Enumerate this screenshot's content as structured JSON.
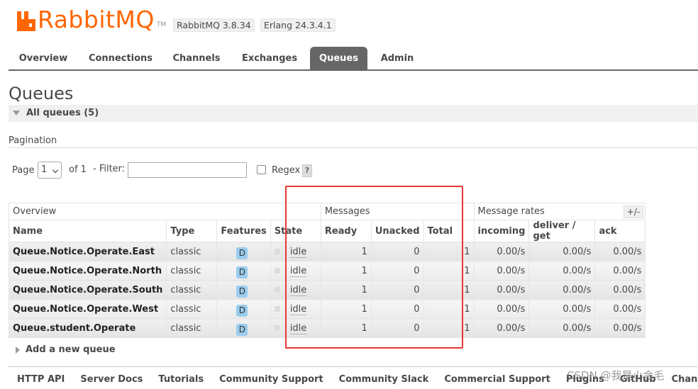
{
  "header": {
    "logo_text": "RabbitMQ",
    "logo_tm": "TM",
    "version": "RabbitMQ 3.8.34",
    "erlang": "Erlang 24.3.4.1"
  },
  "tabs": [
    {
      "label": "Overview"
    },
    {
      "label": "Connections"
    },
    {
      "label": "Channels"
    },
    {
      "label": "Exchanges"
    },
    {
      "label": "Queues"
    },
    {
      "label": "Admin"
    }
  ],
  "page": {
    "title": "Queues",
    "section": "All queues (5)",
    "pagination_label": "Pagination"
  },
  "filter": {
    "page_label": "Page",
    "page_value": "1",
    "of_label": "of 1",
    "filter_label": "- Filter:",
    "filter_value": "",
    "regex_label": "Regex",
    "help": "?"
  },
  "table": {
    "groups": [
      "Overview",
      "Messages",
      "Message rates"
    ],
    "columns": [
      "Name",
      "Type",
      "Features",
      "State",
      "Ready",
      "Unacked",
      "Total",
      "incoming",
      "deliver / get",
      "ack"
    ],
    "toggle": "+/-",
    "rows": [
      {
        "name": "Queue.Notice.Operate.East",
        "type": "classic",
        "feature": "D",
        "state": "idle",
        "ready": "1",
        "unacked": "0",
        "total": "1",
        "incoming": "0.00/s",
        "deliver": "0.00/s",
        "ack": "0.00/s"
      },
      {
        "name": "Queue.Notice.Operate.North",
        "type": "classic",
        "feature": "D",
        "state": "idle",
        "ready": "1",
        "unacked": "0",
        "total": "1",
        "incoming": "0.00/s",
        "deliver": "0.00/s",
        "ack": "0.00/s"
      },
      {
        "name": "Queue.Notice.Operate.South",
        "type": "classic",
        "feature": "D",
        "state": "idle",
        "ready": "1",
        "unacked": "0",
        "total": "1",
        "incoming": "0.00/s",
        "deliver": "0.00/s",
        "ack": "0.00/s"
      },
      {
        "name": "Queue.Notice.Operate.West",
        "type": "classic",
        "feature": "D",
        "state": "idle",
        "ready": "1",
        "unacked": "0",
        "total": "1",
        "incoming": "0.00/s",
        "deliver": "0.00/s",
        "ack": "0.00/s"
      },
      {
        "name": "Queue.student.Operate",
        "type": "classic",
        "feature": "D",
        "state": "idle",
        "ready": "1",
        "unacked": "0",
        "total": "1",
        "incoming": "0.00/s",
        "deliver": "0.00/s",
        "ack": "0.00/s"
      }
    ]
  },
  "add_queue": "Add a new queue",
  "footer": [
    "HTTP API",
    "Server Docs",
    "Tutorials",
    "Community Support",
    "Community Slack",
    "Commercial Support",
    "Plugins",
    "GitHub",
    "Changelog"
  ],
  "watermark": "CSDN @我是小金毛",
  "colors": {
    "brand": "#ff6600",
    "active_tab": "#666666",
    "feature_badge": "#99ccee",
    "highlight": "#e53935"
  }
}
